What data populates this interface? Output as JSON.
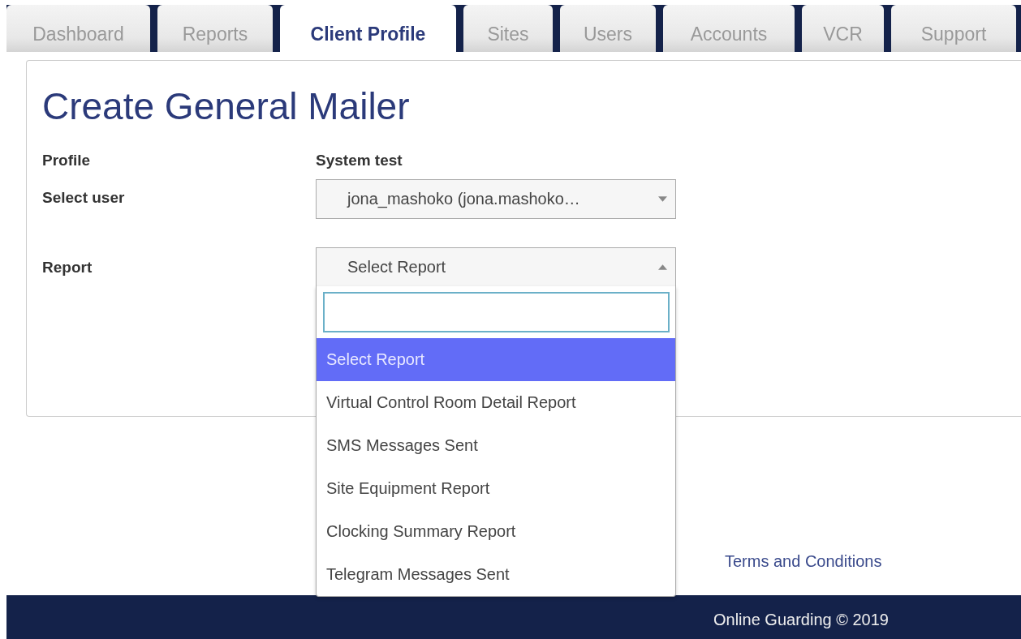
{
  "tabs": [
    {
      "label": "Dashboard",
      "selected": false
    },
    {
      "label": "Reports",
      "selected": false
    },
    {
      "label": "Client Profile",
      "selected": true
    },
    {
      "label": "Sites",
      "selected": false
    },
    {
      "label": "Users",
      "selected": false
    },
    {
      "label": "Accounts",
      "selected": false
    },
    {
      "label": "VCR",
      "selected": false
    },
    {
      "label": "Support",
      "selected": false
    }
  ],
  "page_title": "Create General Mailer",
  "form": {
    "profile": {
      "label": "Profile",
      "value": "System test"
    },
    "select_user": {
      "label": "Select user",
      "value": "jona_mashoko (jona.mashoko…",
      "expanded": false
    },
    "report": {
      "label": "Report",
      "value": "Select Report",
      "expanded": true,
      "options": [
        {
          "label": "Select Report",
          "selected": true
        },
        {
          "label": "Virtual Control Room Detail Report",
          "selected": false
        },
        {
          "label": "SMS Messages Sent",
          "selected": false
        },
        {
          "label": "Site Equipment Report",
          "selected": false
        },
        {
          "label": "Clocking Summary Report",
          "selected": false
        },
        {
          "label": "Telegram Messages Sent",
          "selected": false
        }
      ]
    }
  },
  "footer": {
    "link": "Terms and Conditions",
    "copyright": "Online Guarding © 2019"
  }
}
